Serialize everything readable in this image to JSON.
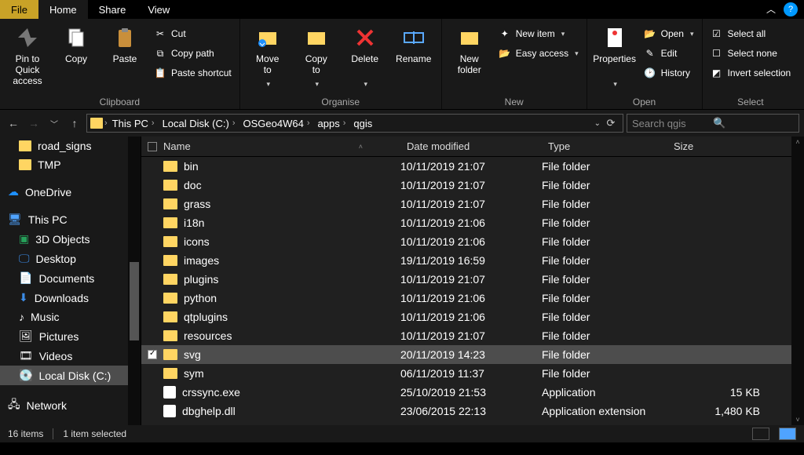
{
  "tabs": {
    "file": "File",
    "home": "Home",
    "share": "Share",
    "view": "View"
  },
  "ribbon": {
    "pin": "Pin to Quick\naccess",
    "copy": "Copy",
    "paste": "Paste",
    "cut": "Cut",
    "copypath": "Copy path",
    "pasteshortcut": "Paste shortcut",
    "clipboard_label": "Clipboard",
    "moveto": "Move\nto",
    "copyto": "Copy\nto",
    "delete": "Delete",
    "rename": "Rename",
    "organise_label": "Organise",
    "newfolder": "New\nfolder",
    "newitem": "New item",
    "easyaccess": "Easy access",
    "new_label": "New",
    "properties": "Properties",
    "open": "Open",
    "edit": "Edit",
    "history": "History",
    "open_label": "Open",
    "selectall": "Select all",
    "selectnone": "Select none",
    "invert": "Invert selection",
    "select_label": "Select"
  },
  "breadcrumb": [
    "This PC",
    "Local Disk (C:)",
    "OSGeo4W64",
    "apps",
    "qgis"
  ],
  "search_placeholder": "Search qgis",
  "columns": {
    "name": "Name",
    "date": "Date modified",
    "type": "Type",
    "size": "Size"
  },
  "navtree": {
    "road_signs": "road_signs",
    "tmp": "TMP",
    "onedrive": "OneDrive",
    "thispc": "This PC",
    "threed": "3D Objects",
    "desktop": "Desktop",
    "documents": "Documents",
    "downloads": "Downloads",
    "music": "Music",
    "pictures": "Pictures",
    "videos": "Videos",
    "localdisk": "Local Disk (C:)",
    "network": "Network"
  },
  "rows": [
    {
      "name": "bin",
      "date": "10/11/2019 21:07",
      "type": "File folder",
      "size": "",
      "icon": "folder",
      "selected": false
    },
    {
      "name": "doc",
      "date": "10/11/2019 21:07",
      "type": "File folder",
      "size": "",
      "icon": "folder",
      "selected": false
    },
    {
      "name": "grass",
      "date": "10/11/2019 21:07",
      "type": "File folder",
      "size": "",
      "icon": "folder",
      "selected": false
    },
    {
      "name": "i18n",
      "date": "10/11/2019 21:06",
      "type": "File folder",
      "size": "",
      "icon": "folder",
      "selected": false
    },
    {
      "name": "icons",
      "date": "10/11/2019 21:06",
      "type": "File folder",
      "size": "",
      "icon": "folder",
      "selected": false
    },
    {
      "name": "images",
      "date": "19/11/2019 16:59",
      "type": "File folder",
      "size": "",
      "icon": "folder",
      "selected": false
    },
    {
      "name": "plugins",
      "date": "10/11/2019 21:07",
      "type": "File folder",
      "size": "",
      "icon": "folder",
      "selected": false
    },
    {
      "name": "python",
      "date": "10/11/2019 21:06",
      "type": "File folder",
      "size": "",
      "icon": "folder",
      "selected": false
    },
    {
      "name": "qtplugins",
      "date": "10/11/2019 21:06",
      "type": "File folder",
      "size": "",
      "icon": "folder",
      "selected": false
    },
    {
      "name": "resources",
      "date": "10/11/2019 21:07",
      "type": "File folder",
      "size": "",
      "icon": "folder",
      "selected": false
    },
    {
      "name": "svg",
      "date": "20/11/2019 14:23",
      "type": "File folder",
      "size": "",
      "icon": "folder",
      "selected": true
    },
    {
      "name": "sym",
      "date": "06/11/2019 11:37",
      "type": "File folder",
      "size": "",
      "icon": "folder",
      "selected": false
    },
    {
      "name": "crssync.exe",
      "date": "25/10/2019 21:53",
      "type": "Application",
      "size": "15 KB",
      "icon": "file",
      "selected": false
    },
    {
      "name": "dbghelp.dll",
      "date": "23/06/2015 22:13",
      "type": "Application extension",
      "size": "1,480 KB",
      "icon": "file",
      "selected": false
    }
  ],
  "status": {
    "count": "16 items",
    "selected": "1 item selected"
  }
}
